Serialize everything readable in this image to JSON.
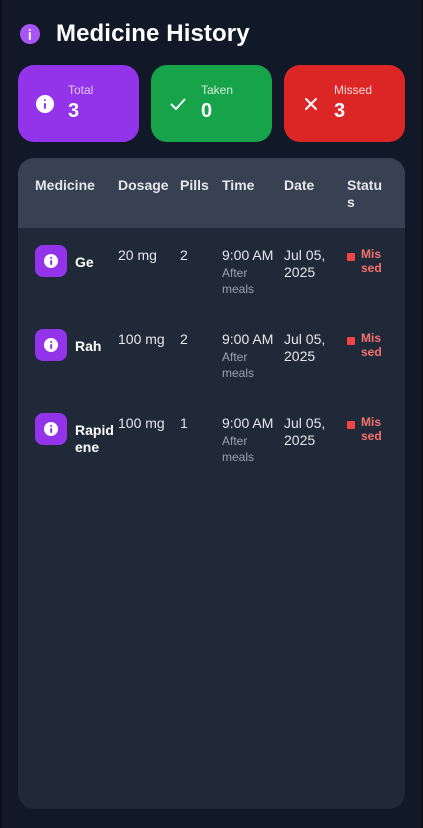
{
  "header": {
    "title": "Medicine History",
    "icon": "info-icon"
  },
  "summary": {
    "total": {
      "label": "Total",
      "value": "3",
      "icon": "info-icon",
      "color": "#9333ea"
    },
    "taken": {
      "label": "Taken",
      "value": "0",
      "icon": "check-icon",
      "color": "#16a34a"
    },
    "missed": {
      "label": "Missed",
      "value": "3",
      "icon": "close-icon",
      "color": "#dc2626"
    }
  },
  "table": {
    "columns": [
      "Medicine",
      "Dosage",
      "Pills",
      "Time",
      "Date",
      "Status"
    ],
    "rows": [
      {
        "medicine": "Ge",
        "dosage": "20 mg",
        "pills": "2",
        "time": "9:00 AM",
        "time_note": "After meals",
        "date": "Jul 05, 2025",
        "status": "Missed"
      },
      {
        "medicine": "Rah",
        "dosage": "100 mg",
        "pills": "2",
        "time": "9:00 AM",
        "time_note": "After meals",
        "date": "Jul 05, 2025",
        "status": "Missed"
      },
      {
        "medicine": "Rapidene",
        "dosage": "100 mg",
        "pills": "1",
        "time": "9:00 AM",
        "time_note": "After meals",
        "date": "Jul 05, 2025",
        "status": "Missed"
      }
    ]
  },
  "colors": {
    "background": "#111827",
    "panel": "#1f2937",
    "header_row": "#374151",
    "accent": "#a855f7",
    "missed": "#ef4444"
  }
}
